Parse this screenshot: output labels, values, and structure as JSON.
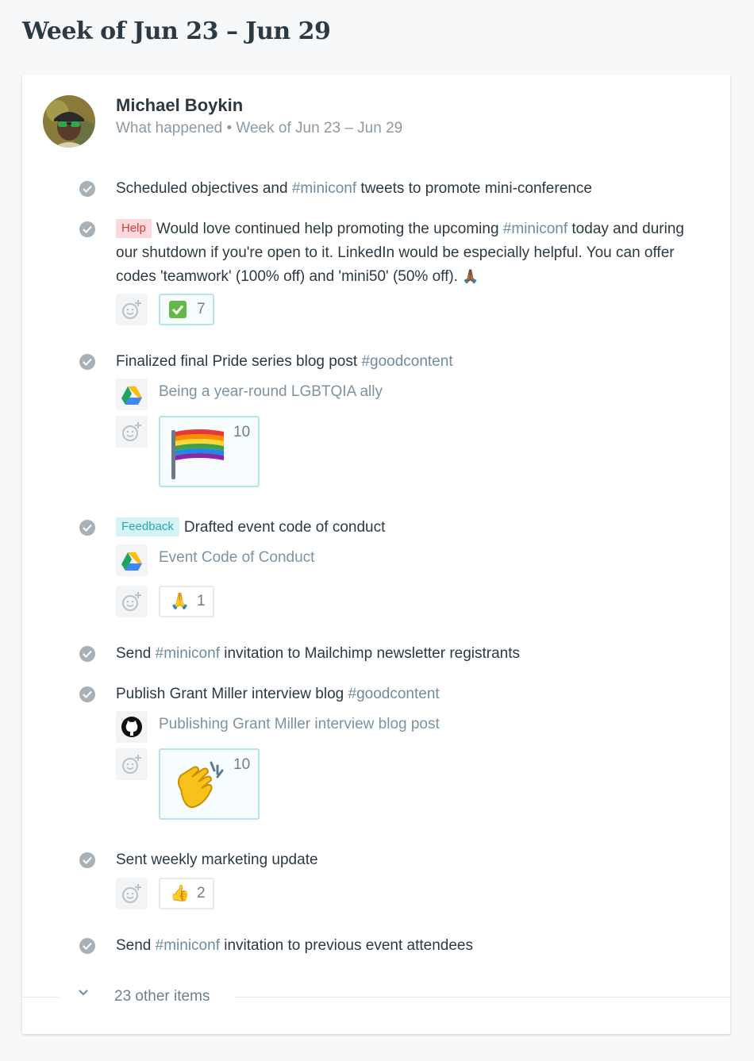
{
  "page": {
    "title": "Week of Jun 23 – Jun 29"
  },
  "user": {
    "name": "Michael Boykin",
    "subtitle": "What happened • Week of Jun 23 – Jun 29"
  },
  "items": [
    {
      "segments": [
        "Scheduled objectives and ",
        "#miniconf",
        " tweets to promote mini-conference"
      ]
    },
    {
      "pill": "Help",
      "segments": [
        "Would love continued help promoting the upcoming ",
        "#miniconf",
        " today and during our shutdown if you're open to it. LinkedIn would be especially helpful. You can offer codes 'teamwork' (100% off) and 'mini50' (50% off). ",
        "🙏🏾"
      ],
      "reaction": {
        "emoji": "✅",
        "count": "7"
      }
    },
    {
      "segments": [
        "Finalized final Pride series blog post ",
        "#goodcontent"
      ],
      "attachment": {
        "icon": "google-drive-icon",
        "label": "Being a year-round LGBTQIA ally"
      },
      "reaction": {
        "emoji": "rainbow-flag",
        "count": "10"
      }
    },
    {
      "pill": "Feedback",
      "segments": [
        "Drafted event code of conduct"
      ],
      "attachment": {
        "icon": "google-drive-icon",
        "label": "Event Code of Conduct"
      },
      "reaction": {
        "emoji": "🙏",
        "count": "1"
      }
    },
    {
      "segments": [
        "Send ",
        "#miniconf",
        " invitation to Mailchimp newsletter registrants"
      ]
    },
    {
      "segments": [
        "Publish Grant Miller interview blog ",
        "#goodcontent"
      ],
      "attachment": {
        "icon": "github-icon",
        "label": "Publishing Grant Miller interview blog post"
      },
      "reaction": {
        "emoji": "clapping-hands",
        "count": "10"
      }
    },
    {
      "segments": [
        "Sent weekly marketing update"
      ],
      "reaction": {
        "emoji": "👍",
        "count": "2"
      }
    },
    {
      "segments": [
        "Send ",
        "#miniconf",
        " invitation to previous event attendees"
      ]
    }
  ],
  "more": {
    "label": "23 other items"
  },
  "colors": {
    "accent_tag": "#6e8c9e",
    "help_bg": "#fbd9dd",
    "feedback_bg": "#d6f3f5",
    "check": "#a8b1b8"
  }
}
